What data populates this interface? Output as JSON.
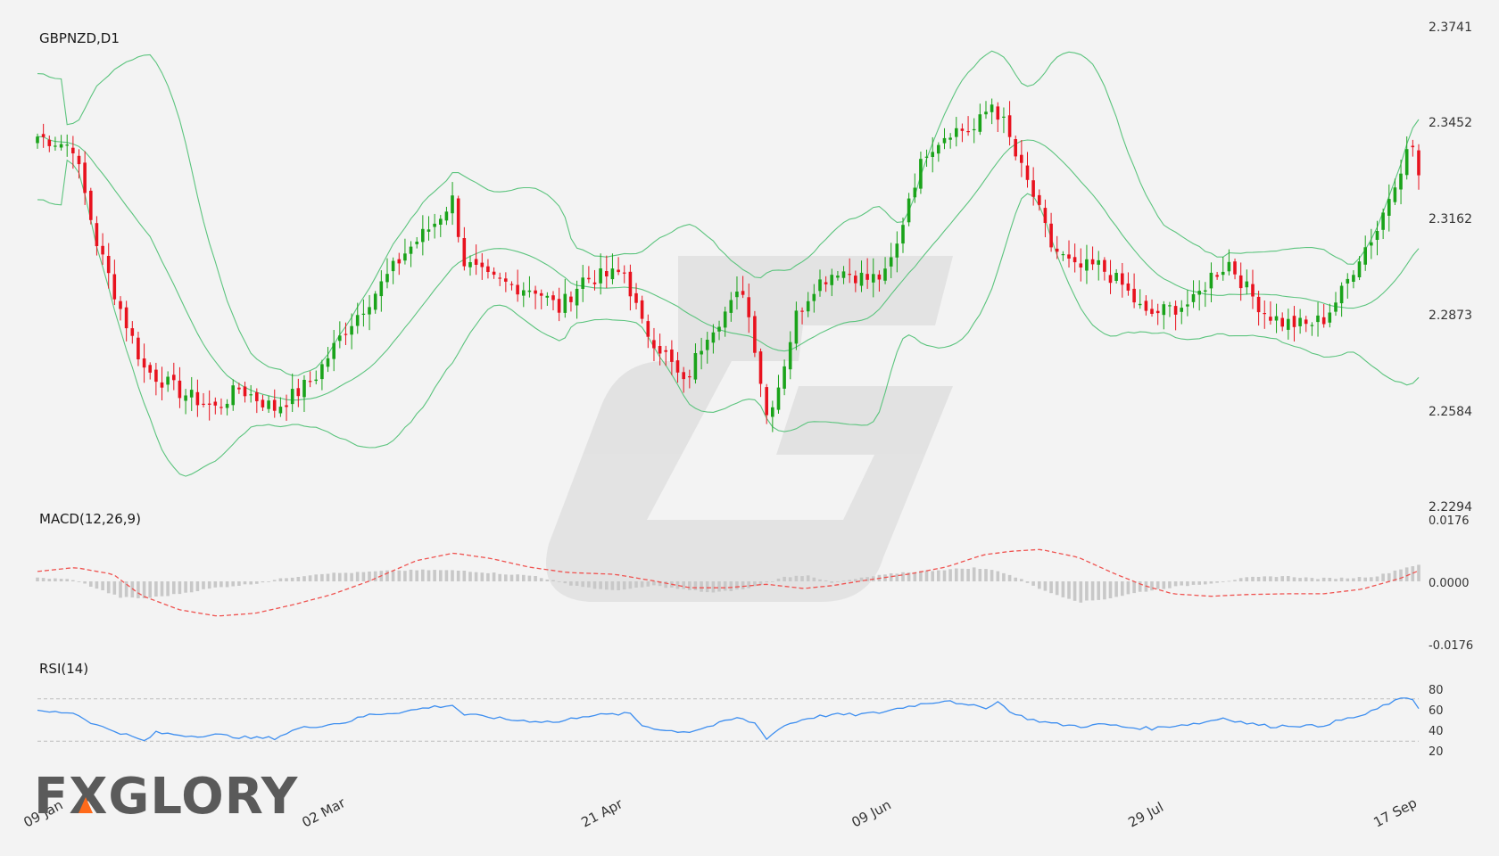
{
  "colors": {
    "background": "#f3f3f3",
    "bull": "#1aa31a",
    "bear": "#e8121e",
    "bollinger": "#5cc47e",
    "macd_signal": "#ef5350",
    "macd_hist": "#c8c8c8",
    "rsi": "#3d8ef0",
    "rsi_levels": "#bdbdbd",
    "watermark": "#e2e2e2",
    "logo": "#5a5a5a",
    "logo_accent": "#ff6a1a"
  },
  "brand": {
    "logo_text": "FXGLORY",
    "watermark_icon": "fxglory-g-icon"
  },
  "chart_data": [
    {
      "type": "candlestick",
      "title": "GBPNZD,D1",
      "ylim": [
        2.2294,
        2.3741
      ],
      "yticks": [
        "2.3741",
        "2.3452",
        "2.3162",
        "2.2873",
        "2.2584",
        "2.2294"
      ],
      "xticks": [
        "09 Jan",
        "02 Mar",
        "21 Apr",
        "09 Jun",
        "29 Jul",
        "17 Sep"
      ],
      "overlays": [
        "Bollinger Bands (upper, middle, lower)"
      ],
      "start_close": 2.341,
      "daily_closes_keypoints": [
        [
          0,
          2.341
        ],
        [
          6,
          2.338
        ],
        [
          10,
          2.309
        ],
        [
          14,
          2.289
        ],
        [
          18,
          2.271
        ],
        [
          24,
          2.264
        ],
        [
          30,
          2.259
        ],
        [
          34,
          2.265
        ],
        [
          40,
          2.259
        ],
        [
          44,
          2.264
        ],
        [
          47,
          2.269
        ],
        [
          52,
          2.283
        ],
        [
          57,
          2.294
        ],
        [
          62,
          2.306
        ],
        [
          67,
          2.315
        ],
        [
          70,
          2.322
        ],
        [
          72,
          2.303
        ],
        [
          76,
          2.298
        ],
        [
          80,
          2.296
        ],
        [
          84,
          2.295
        ],
        [
          88,
          2.289
        ],
        [
          92,
          2.298
        ],
        [
          96,
          2.299
        ],
        [
          99,
          2.3
        ],
        [
          102,
          2.284
        ],
        [
          106,
          2.275
        ],
        [
          109,
          2.266
        ],
        [
          113,
          2.282
        ],
        [
          117,
          2.29
        ],
        [
          119,
          2.295
        ],
        [
          121,
          2.278
        ],
        [
          123,
          2.257
        ],
        [
          125,
          2.266
        ],
        [
          128,
          2.287
        ],
        [
          131,
          2.296
        ],
        [
          135,
          2.301
        ],
        [
          140,
          2.298
        ],
        [
          143,
          2.299
        ],
        [
          145,
          2.308
        ],
        [
          147,
          2.323
        ],
        [
          150,
          2.337
        ],
        [
          154,
          2.343
        ],
        [
          158,
          2.343
        ],
        [
          161,
          2.351
        ],
        [
          163,
          2.345
        ],
        [
          165,
          2.335
        ],
        [
          168,
          2.323
        ],
        [
          171,
          2.308
        ],
        [
          175,
          2.301
        ],
        [
          179,
          2.302
        ],
        [
          183,
          2.296
        ],
        [
          187,
          2.287
        ],
        [
          191,
          2.289
        ],
        [
          195,
          2.291
        ],
        [
          198,
          2.299
        ],
        [
          201,
          2.303
        ],
        [
          204,
          2.295
        ],
        [
          207,
          2.288
        ],
        [
          210,
          2.285
        ],
        [
          214,
          2.284
        ],
        [
          217,
          2.286
        ],
        [
          220,
          2.294
        ],
        [
          223,
          2.305
        ],
        [
          226,
          2.313
        ],
        [
          229,
          2.328
        ],
        [
          231,
          2.336
        ],
        [
          232,
          2.338
        ],
        [
          233,
          2.329
        ]
      ],
      "total_bars": 234
    },
    {
      "type": "line",
      "title": "MACD(12,26,9)",
      "ylim": [
        -0.0176,
        0.0176
      ],
      "yticks": [
        "0.0176",
        "0.0000",
        "-0.0176"
      ],
      "series": [
        {
          "name": "histogram",
          "kind": "bar"
        },
        {
          "name": "signal",
          "kind": "dashed-line"
        }
      ],
      "signal_keypoints": [
        [
          0,
          0.0028
        ],
        [
          8,
          0.0039
        ],
        [
          16,
          0.002
        ],
        [
          22,
          -0.004
        ],
        [
          30,
          -0.008
        ],
        [
          38,
          -0.0098
        ],
        [
          46,
          -0.009
        ],
        [
          54,
          -0.0066
        ],
        [
          62,
          -0.0038
        ],
        [
          70,
          0.0
        ],
        [
          80,
          0.0058
        ],
        [
          88,
          0.008
        ],
        [
          96,
          0.0064
        ],
        [
          104,
          0.004
        ],
        [
          112,
          0.0025
        ],
        [
          122,
          0.002
        ],
        [
          130,
          0.0002
        ],
        [
          138,
          -0.0018
        ],
        [
          146,
          -0.0018
        ],
        [
          154,
          -0.0008
        ],
        [
          162,
          -0.002
        ],
        [
          168,
          -0.0012
        ],
        [
          176,
          0.0005
        ],
        [
          184,
          0.002
        ],
        [
          192,
          0.004
        ],
        [
          200,
          0.0075
        ],
        [
          206,
          0.0085
        ],
        [
          212,
          0.009
        ],
        [
          220,
          0.0068
        ],
        [
          228,
          0.002
        ],
        [
          234,
          -0.0012
        ],
        [
          240,
          -0.0035
        ],
        [
          248,
          -0.0042
        ],
        [
          256,
          -0.0037
        ],
        [
          264,
          -0.0035
        ],
        [
          272,
          -0.0035
        ],
        [
          280,
          -0.0022
        ],
        [
          288,
          0.0008
        ],
        [
          292,
          0.003
        ]
      ],
      "histogram_keypoints": [
        [
          0,
          0.001
        ],
        [
          6,
          0.0005
        ],
        [
          10,
          -0.002
        ],
        [
          14,
          -0.0045
        ],
        [
          18,
          -0.0048
        ],
        [
          22,
          -0.004
        ],
        [
          30,
          -0.0018
        ],
        [
          36,
          -0.0008
        ],
        [
          42,
          0.001
        ],
        [
          48,
          0.0022
        ],
        [
          54,
          0.0025
        ],
        [
          60,
          0.003
        ],
        [
          66,
          0.0032
        ],
        [
          72,
          0.003
        ],
        [
          78,
          0.0022
        ],
        [
          84,
          0.0015
        ],
        [
          90,
          -0.001
        ],
        [
          96,
          -0.0025
        ],
        [
          100,
          -0.0022
        ],
        [
          104,
          -0.0012
        ],
        [
          110,
          -0.0025
        ],
        [
          114,
          -0.0032
        ],
        [
          120,
          -0.002
        ],
        [
          126,
          0.0012
        ],
        [
          130,
          0.0018
        ],
        [
          134,
          -0.0005
        ],
        [
          140,
          0.0012
        ],
        [
          146,
          0.0025
        ],
        [
          152,
          0.0032
        ],
        [
          158,
          0.0038
        ],
        [
          162,
          0.003
        ],
        [
          166,
          0.0005
        ],
        [
          170,
          -0.0028
        ],
        [
          176,
          -0.0058
        ],
        [
          180,
          -0.005
        ],
        [
          186,
          -0.003
        ],
        [
          192,
          -0.0015
        ],
        [
          198,
          -0.0005
        ],
        [
          204,
          0.001
        ],
        [
          210,
          0.0015
        ],
        [
          216,
          0.0008
        ],
        [
          222,
          0.001
        ],
        [
          226,
          0.0015
        ],
        [
          230,
          0.0035
        ],
        [
          233,
          0.0048
        ]
      ]
    },
    {
      "type": "line",
      "title": "RSI(14)",
      "ylim": [
        10,
        90
      ],
      "yticks": [
        "80",
        "60",
        "40",
        "20"
      ],
      "levels": [
        70,
        30
      ],
      "keypoints": [
        [
          0,
          58
        ],
        [
          6,
          57
        ],
        [
          10,
          45
        ],
        [
          14,
          38
        ],
        [
          18,
          30
        ],
        [
          20,
          38
        ],
        [
          26,
          35
        ],
        [
          30,
          36
        ],
        [
          36,
          33
        ],
        [
          40,
          33
        ],
        [
          44,
          42
        ],
        [
          48,
          45
        ],
        [
          52,
          48
        ],
        [
          56,
          55
        ],
        [
          62,
          58
        ],
        [
          66,
          62
        ],
        [
          70,
          64
        ],
        [
          72,
          55
        ],
        [
          76,
          53
        ],
        [
          80,
          50
        ],
        [
          84,
          49
        ],
        [
          88,
          48
        ],
        [
          92,
          54
        ],
        [
          96,
          55
        ],
        [
          100,
          56
        ],
        [
          102,
          45
        ],
        [
          106,
          40
        ],
        [
          110,
          39
        ],
        [
          114,
          45
        ],
        [
          118,
          52
        ],
        [
          121,
          47
        ],
        [
          123,
          33
        ],
        [
          126,
          45
        ],
        [
          130,
          52
        ],
        [
          134,
          55
        ],
        [
          138,
          55
        ],
        [
          142,
          57
        ],
        [
          146,
          62
        ],
        [
          150,
          66
        ],
        [
          154,
          69
        ],
        [
          156,
          64
        ],
        [
          160,
          62
        ],
        [
          162,
          67
        ],
        [
          165,
          55
        ],
        [
          168,
          50
        ],
        [
          172,
          46
        ],
        [
          176,
          44
        ],
        [
          180,
          46
        ],
        [
          184,
          43
        ],
        [
          188,
          42
        ],
        [
          192,
          45
        ],
        [
          196,
          47
        ],
        [
          200,
          52
        ],
        [
          204,
          47
        ],
        [
          208,
          44
        ],
        [
          212,
          45
        ],
        [
          216,
          44
        ],
        [
          220,
          50
        ],
        [
          224,
          55
        ],
        [
          228,
          66
        ],
        [
          231,
          71
        ],
        [
          232,
          70
        ],
        [
          233,
          61
        ]
      ]
    }
  ]
}
